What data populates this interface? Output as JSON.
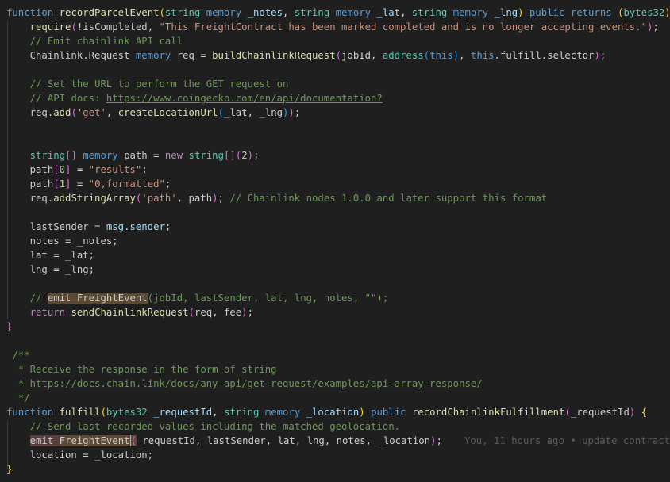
{
  "editor": {
    "lines": [
      [
        [
          "k",
          "function "
        ],
        [
          "f",
          "recordParcelEvent"
        ],
        [
          "b1",
          "("
        ],
        [
          "t",
          "string"
        ],
        [
          "p",
          " "
        ],
        [
          "k",
          "memory"
        ],
        [
          "p",
          " "
        ],
        [
          "v",
          "_notes"
        ],
        [
          "p",
          ", "
        ],
        [
          "t",
          "string"
        ],
        [
          "p",
          " "
        ],
        [
          "k",
          "memory"
        ],
        [
          "p",
          " "
        ],
        [
          "v",
          "_lat"
        ],
        [
          "p",
          ", "
        ],
        [
          "t",
          "string"
        ],
        [
          "p",
          " "
        ],
        [
          "k",
          "memory"
        ],
        [
          "p",
          " "
        ],
        [
          "v",
          "_lng"
        ],
        [
          "b1",
          ")"
        ],
        [
          "p",
          " "
        ],
        [
          "k",
          "public"
        ],
        [
          "p",
          " "
        ],
        [
          "k",
          "returns"
        ],
        [
          "p",
          " "
        ],
        [
          "b1",
          "("
        ],
        [
          "t",
          "bytes32"
        ],
        [
          "b1",
          ")"
        ],
        [
          "p",
          " "
        ],
        [
          "b1",
          "{"
        ]
      ],
      [
        [
          "p",
          "    "
        ],
        [
          "f",
          "require"
        ],
        [
          "b2",
          "("
        ],
        [
          "p",
          "!isCompleted, "
        ],
        [
          "s",
          "\"This FreightContract has been marked completed and is no longer accepting events.\""
        ],
        [
          "b2",
          ")"
        ],
        [
          "p",
          ";"
        ]
      ],
      [
        [
          "p",
          "    "
        ],
        [
          "m",
          "// Emit chainlink API call"
        ]
      ],
      [
        [
          "p",
          "    Chainlink.Request "
        ],
        [
          "k",
          "memory"
        ],
        [
          "p",
          " req = "
        ],
        [
          "f",
          "buildChainlinkRequest"
        ],
        [
          "b2",
          "("
        ],
        [
          "p",
          "jobId, "
        ],
        [
          "t",
          "address"
        ],
        [
          "b3",
          "("
        ],
        [
          "k",
          "this"
        ],
        [
          "b3",
          ")"
        ],
        [
          "p",
          ", "
        ],
        [
          "k",
          "this"
        ],
        [
          "p",
          ".fulfill.selector"
        ],
        [
          "b2",
          ")"
        ],
        [
          "p",
          ";"
        ]
      ],
      [],
      [
        [
          "p",
          "    "
        ],
        [
          "m",
          "// Set the URL to perform the GET request on"
        ]
      ],
      [
        [
          "p",
          "    "
        ],
        [
          "m",
          "// API docs: "
        ],
        [
          "u",
          "https://www.coingecko.com/en/api/documentation?"
        ]
      ],
      [
        [
          "p",
          "    req."
        ],
        [
          "f",
          "add"
        ],
        [
          "b2",
          "("
        ],
        [
          "s",
          "'get'"
        ],
        [
          "p",
          ", "
        ],
        [
          "f",
          "createLocationUrl"
        ],
        [
          "b3",
          "("
        ],
        [
          "p",
          "_lat, _lng"
        ],
        [
          "b3",
          ")"
        ],
        [
          "b2",
          ")"
        ],
        [
          "p",
          ";"
        ]
      ],
      [],
      [],
      [
        [
          "p",
          "    "
        ],
        [
          "t",
          "string"
        ],
        [
          "b2",
          "[]"
        ],
        [
          "p",
          " "
        ],
        [
          "k",
          "memory"
        ],
        [
          "p",
          " path = "
        ],
        [
          "c",
          "new"
        ],
        [
          "p",
          " "
        ],
        [
          "t",
          "string"
        ],
        [
          "b2",
          "[]"
        ],
        [
          "b2",
          "("
        ],
        [
          "n",
          "2"
        ],
        [
          "b2",
          ")"
        ],
        [
          "p",
          ";"
        ]
      ],
      [
        [
          "p",
          "    path"
        ],
        [
          "b2",
          "["
        ],
        [
          "n",
          "0"
        ],
        [
          "b2",
          "]"
        ],
        [
          "p",
          " = "
        ],
        [
          "s",
          "\"results\""
        ],
        [
          "p",
          ";"
        ]
      ],
      [
        [
          "p",
          "    path"
        ],
        [
          "b2",
          "["
        ],
        [
          "n",
          "1"
        ],
        [
          "b2",
          "]"
        ],
        [
          "p",
          " = "
        ],
        [
          "s",
          "\"0,formatted\""
        ],
        [
          "p",
          ";"
        ]
      ],
      [
        [
          "p",
          "    req."
        ],
        [
          "f",
          "addStringArray"
        ],
        [
          "b2",
          "("
        ],
        [
          "s",
          "'path'"
        ],
        [
          "p",
          ", path"
        ],
        [
          "b2",
          ")"
        ],
        [
          "p",
          "; "
        ],
        [
          "m",
          "// Chainlink nodes 1.0.0 and later support this format"
        ]
      ],
      [],
      [
        [
          "p",
          "    lastSender = "
        ],
        [
          "v",
          "msg"
        ],
        [
          "p",
          "."
        ],
        [
          "v",
          "sender"
        ],
        [
          "p",
          ";"
        ]
      ],
      [
        [
          "p",
          "    notes = _notes;"
        ]
      ],
      [
        [
          "p",
          "    lat = _lat;"
        ]
      ],
      [
        [
          "p",
          "    lng = _lng;"
        ]
      ],
      [],
      [
        [
          "p",
          "    "
        ],
        [
          "m",
          "// "
        ],
        [
          "hl",
          "emit FreightEvent"
        ],
        [
          "m",
          "(jobId, lastSender, lat, lng, notes, \"\");"
        ]
      ],
      [
        [
          "p",
          "    "
        ],
        [
          "c",
          "return"
        ],
        [
          "p",
          " "
        ],
        [
          "f",
          "sendChainlinkRequest"
        ],
        [
          "b2",
          "("
        ],
        [
          "p",
          "req, fee"
        ],
        [
          "b2",
          ")"
        ],
        [
          "p",
          ";"
        ]
      ],
      [
        [
          "b2",
          "}"
        ]
      ],
      [],
      [
        [
          "p",
          " "
        ],
        [
          "m",
          "/**"
        ]
      ],
      [
        [
          "p",
          "  "
        ],
        [
          "m",
          "* Receive the response in the form of string"
        ]
      ],
      [
        [
          "p",
          "  "
        ],
        [
          "m",
          "* "
        ],
        [
          "u",
          "https://docs.chain.link/docs/any-api/get-request/examples/api-array-response/"
        ]
      ],
      [
        [
          "p",
          "  "
        ],
        [
          "m",
          "*/"
        ]
      ],
      [
        [
          "k",
          "function "
        ],
        [
          "f",
          "fulfill"
        ],
        [
          "b1",
          "("
        ],
        [
          "t",
          "bytes32"
        ],
        [
          "p",
          " "
        ],
        [
          "v",
          "_requestId"
        ],
        [
          "p",
          ", "
        ],
        [
          "t",
          "string"
        ],
        [
          "p",
          " "
        ],
        [
          "k",
          "memory"
        ],
        [
          "p",
          " "
        ],
        [
          "v",
          "_location"
        ],
        [
          "b1",
          ")"
        ],
        [
          "p",
          " "
        ],
        [
          "k",
          "public"
        ],
        [
          "p",
          " "
        ],
        [
          "f",
          "recordChainlinkFulfillment"
        ],
        [
          "b2",
          "("
        ],
        [
          "p",
          "_requestId"
        ],
        [
          "b2",
          ")"
        ],
        [
          "p",
          " "
        ],
        [
          "b1",
          "{"
        ]
      ],
      [
        [
          "p",
          "    "
        ],
        [
          "m",
          "// Send last recorded values including the matched geolocation."
        ]
      ],
      [
        [
          "p",
          "    "
        ],
        [
          "hl2",
          "emit "
        ],
        [
          "hl",
          "FreightEvent"
        ],
        [
          "cursor",
          "("
        ],
        [
          "p",
          "_requestId, lastSender, lat, lng, notes, _location"
        ],
        [
          "b2",
          ")"
        ],
        [
          "p",
          ";"
        ]
      ],
      [
        [
          "p",
          "    location = _location;"
        ]
      ],
      [
        [
          "b1",
          "}"
        ]
      ]
    ],
    "blame": {
      "line": 30,
      "text": "You, 11 hours ago • update contract"
    }
  }
}
